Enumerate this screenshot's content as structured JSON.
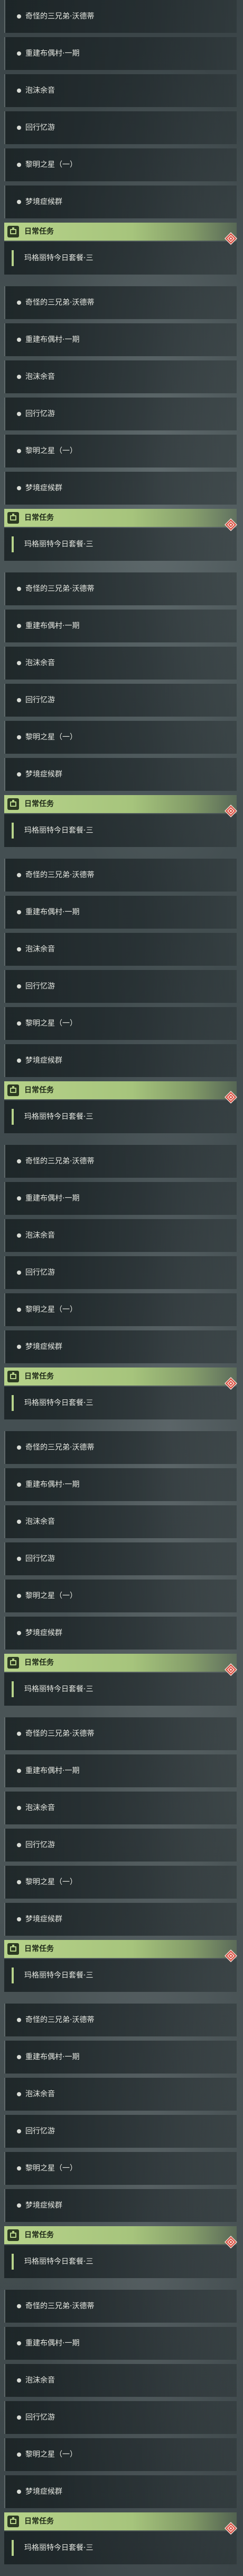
{
  "quests": [
    {
      "label": "奇怪的三兄弟·沃德蒂"
    },
    {
      "label": "重建布偶村·一期"
    },
    {
      "label": "泡沫余音"
    },
    {
      "label": "回行忆游"
    },
    {
      "label": "黎明之星（一）"
    },
    {
      "label": "梦境症候群"
    }
  ],
  "daily": {
    "header_label": "日常任务",
    "quest_label": "玛格丽特今日套餐·三"
  },
  "icons": {
    "quest_dot": "dot-icon",
    "daily_badge": "calendar-icon",
    "marker": "quest-marker-icon"
  },
  "colors": {
    "accent_green": "#b7d38a",
    "marker_red": "#d84a3c"
  }
}
